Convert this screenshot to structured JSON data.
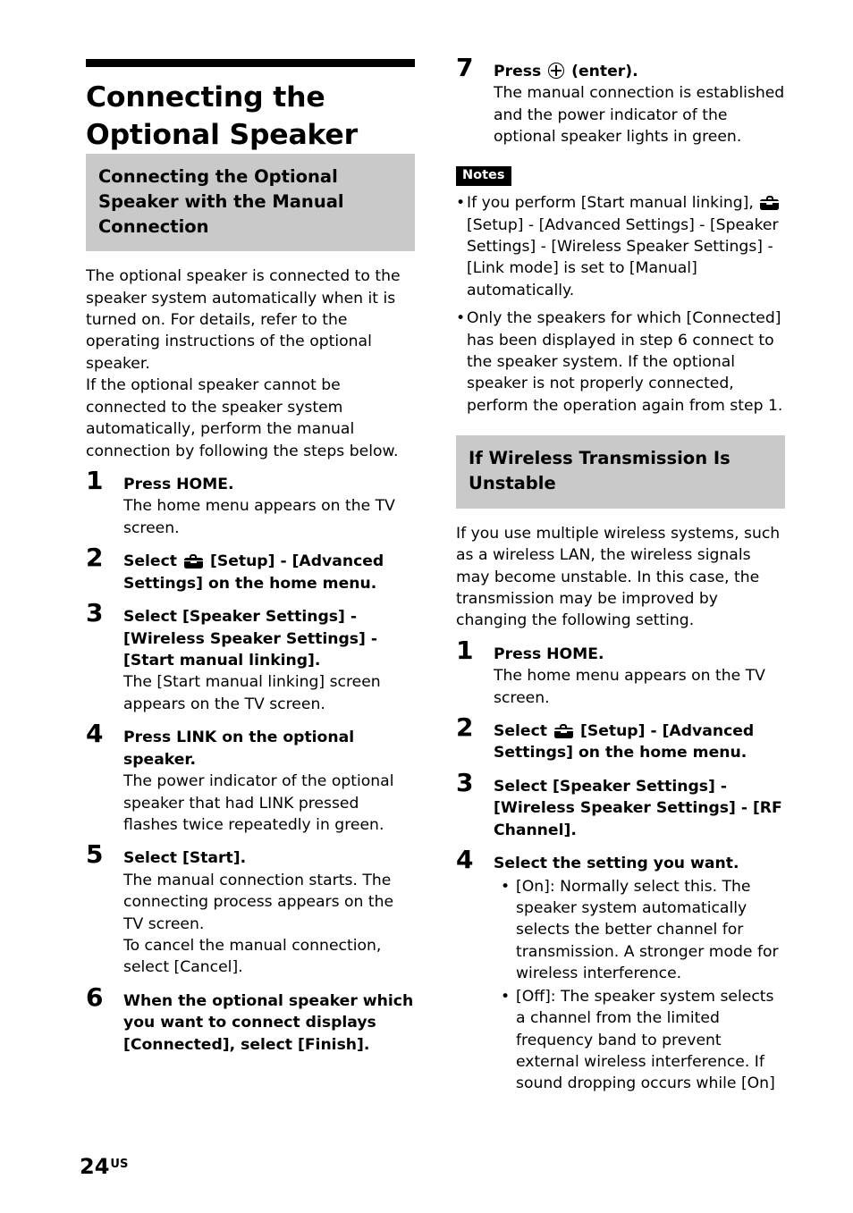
{
  "document": {
    "chapter_title": "Connecting the Optional Speaker",
    "page_number": "24",
    "page_suffix": "US"
  },
  "icons": {
    "setup_toolbox": "toolbox-icon",
    "enter_button": "enter-icon"
  },
  "colors": {
    "heading_background": "#c9c9c9",
    "rule": "#000000",
    "notes_badge_background": "#000000",
    "notes_badge_text": "#ffffff",
    "text": "#000000"
  },
  "left_column": {
    "section_heading": "Connecting the Optional Speaker with the Manual Connection",
    "intro_paragraphs": [
      "The optional speaker is connected to the speaker system automatically when it is turned on. For details, refer to the operating instructions of the optional speaker.",
      "If the optional speaker cannot be connected to the speaker system automatically, perform the manual connection by following the steps below."
    ],
    "steps": [
      {
        "number": "1",
        "title": "Press HOME.",
        "body": "The home menu appears on the TV screen."
      },
      {
        "number": "2",
        "title_before_icon": "Select ",
        "title_after_icon": " [Setup] - [Advanced Settings] on the home menu."
      },
      {
        "number": "3",
        "title": "Select [Speaker Settings] - [Wireless Speaker Settings] - [Start manual linking].",
        "body": "The [Start manual linking] screen appears on the TV screen."
      },
      {
        "number": "4",
        "title": "Press LINK on the optional speaker.",
        "body": "The power indicator of the optional speaker that had LINK pressed flashes twice repeatedly in green."
      },
      {
        "number": "5",
        "title": "Select [Start].",
        "body": "The manual connection starts. The connecting process appears on the TV screen.",
        "body2": "To cancel the manual connection, select [Cancel]."
      },
      {
        "number": "6",
        "title": "When the optional speaker which you want to connect displays [Connected], select [Finish]."
      }
    ]
  },
  "right_column": {
    "step7": {
      "number": "7",
      "title_before_icon": "Press ",
      "title_after_icon": " (enter).",
      "body": "The manual connection is established and the power indicator of the optional speaker lights in green."
    },
    "notes": {
      "badge": "Notes",
      "items": [
        {
          "text_before_icon": "If you perform [Start manual linking], ",
          "text_after_icon": " [Setup] - [Advanced Settings] - [Speaker Settings] - [Wireless Speaker Settings] - [Link mode] is set to [Manual] automatically."
        },
        {
          "text": "Only the speakers for which [Connected] has been displayed in step 6 connect to the speaker system. If the optional speaker is not properly connected, perform the operation again from step 1."
        }
      ]
    },
    "section_heading": "If Wireless Transmission Is Unstable",
    "intro_paragraph": "If you use multiple wireless systems, such as a wireless LAN, the wireless signals may become unstable. In this case, the transmission may be improved by changing the following setting.",
    "steps": [
      {
        "number": "1",
        "title": "Press HOME.",
        "body": "The home menu appears on the TV screen."
      },
      {
        "number": "2",
        "title_before_icon": "Select ",
        "title_after_icon": " [Setup] - [Advanced Settings] on the home menu."
      },
      {
        "number": "3",
        "title": "Select [Speaker Settings] - [Wireless Speaker Settings] - [RF Channel]."
      },
      {
        "number": "4",
        "title": "Select the setting you want.",
        "bullets": [
          "[On]: Normally select this. The speaker system automatically selects the better channel for transmission. A stronger mode for wireless interference.",
          "[Off]: The speaker system selects a channel from the limited frequency band to prevent external wireless interference. If sound dropping occurs while [On]"
        ]
      }
    ]
  }
}
